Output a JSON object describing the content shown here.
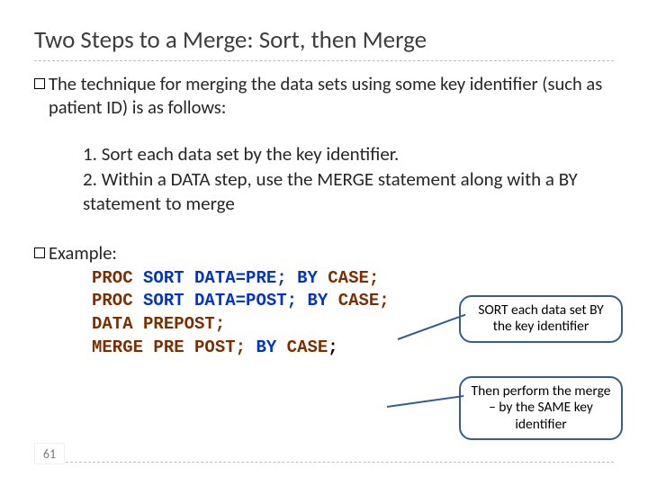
{
  "title": "Two Steps to a Merge: Sort, then Merge",
  "intro": "The technique for merging the data sets using some key identifier (such as patient ID) is as follows:",
  "steps_text": "1. Sort each data set by the key identifier.\n2. Within a DATA step, use the MERGE statement along with a BY statement to merge",
  "example_label": "Example:",
  "code": {
    "l1a": "PROC",
    "l1b": "SORT",
    "l1c": "DATA=PRE;",
    "l1d": "BY",
    "l1e": "CASE;",
    "l2a": "PROC",
    "l2b": "SORT",
    "l2c": "DATA=POST;",
    "l2d": "BY",
    "l2e": "CASE;",
    "l3a": "DATA",
    "l3b": "PREPOST;",
    "l4a": "MERGE",
    "l4b": "PRE POST;",
    "l4c": "BY",
    "l4d": "CASE",
    "semi": ";"
  },
  "callout1": "SORT each data set BY the key identifier",
  "callout2": "Then perform the merge – by the SAME key identifier",
  "page_number": "61"
}
